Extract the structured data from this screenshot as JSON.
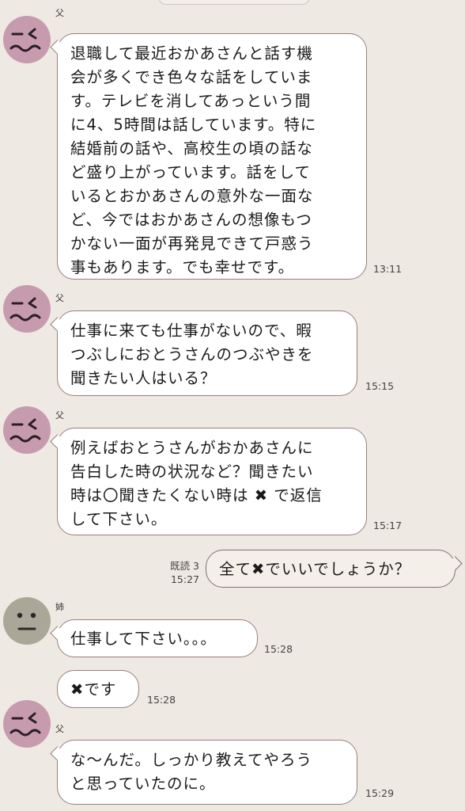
{
  "messages": [
    {
      "sender": "父",
      "text": "退職して最近おかあさんと話す機\n会が多くでき色々な話をしていま\nす。テレビを消してあっという間\nに4、5時間は話しています。特に\n結婚前の話や、高校生の頃の話な\nど盛り上がっています。話をして\nいるとおかあさんの意外な一面な\nど、今ではおかあさんの想像もつ\nかない一面が再発見できて戸惑う\n事もあります。でも幸せです。",
      "time": "13:11"
    },
    {
      "sender": "父",
      "text": "仕事に来ても仕事がないので、暇\nつぶしにおとうさんのつぶやきを\n聞きたい人はいる？",
      "time": "15:15"
    },
    {
      "sender": "父",
      "text": "例えばおとうさんがおかあさんに\n告白した時の状況など？聞きたい\n時は〇聞きたくない時は ✖ で返信\nして下さい。",
      "time": "15:17"
    },
    {
      "sender": "me",
      "text": "全て✖でいいでしょうか？",
      "read": "既読 3",
      "time": "15:27"
    },
    {
      "sender": "姉",
      "text": "仕事して下さい。。。",
      "time": "15:28"
    },
    {
      "sender": "姉",
      "text": "✖です",
      "time": "15:28"
    },
    {
      "sender": "父",
      "text": "な〜んだ。しっかり教えてやろう\nと思っていたのに。",
      "time": "15:29"
    }
  ]
}
